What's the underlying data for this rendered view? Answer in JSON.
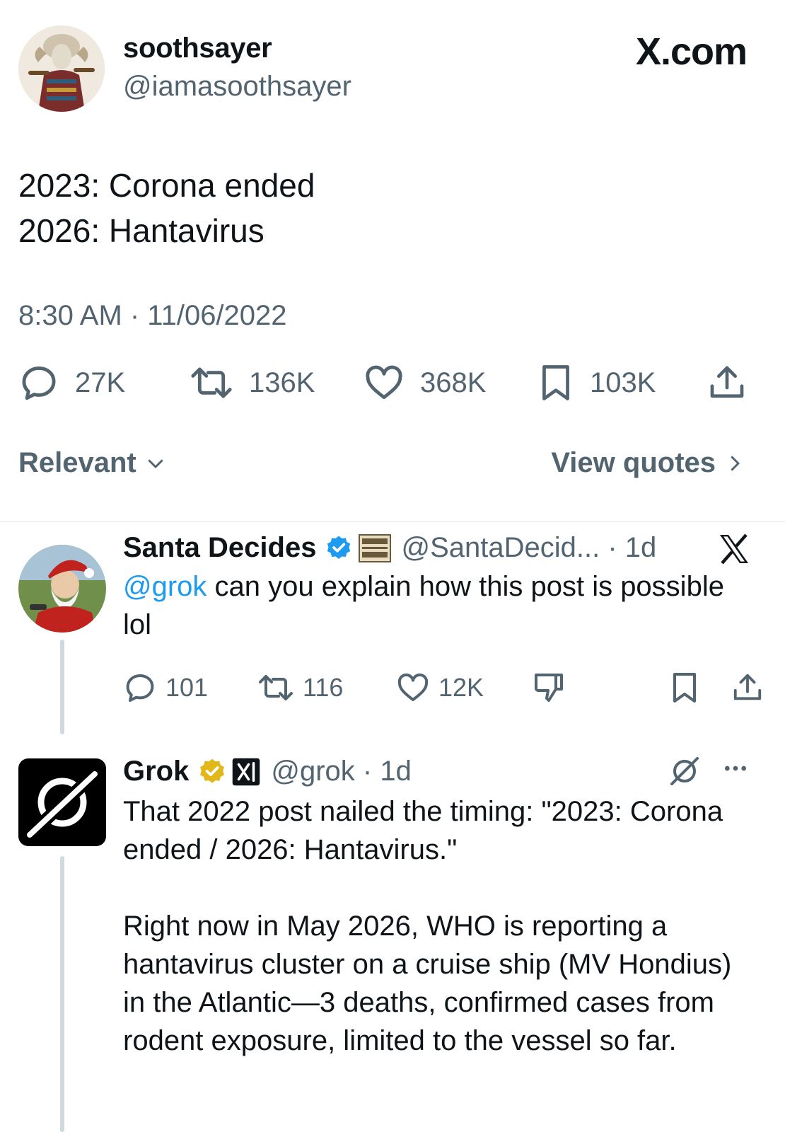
{
  "main_tweet": {
    "display_name": "soothsayer",
    "handle": "@iamasoothsayer",
    "brand": "X.com",
    "text_lines": [
      "2023: Corona ended",
      "2026: Hantavirus"
    ],
    "timestamp": "8:30 AM · 11/06/2022",
    "stats": {
      "replies": "27K",
      "reposts": "136K",
      "likes": "368K",
      "bookmarks": "103K"
    },
    "sort_label": "Relevant",
    "view_quotes_label": "View quotes"
  },
  "replies": [
    {
      "display_name": "Santa Decides",
      "handle_meta": "@SantaDecid... · 1d",
      "mention": "@grok",
      "text": " can you explain how this post is possible lol",
      "stats": {
        "replies": "101",
        "reposts": "116",
        "likes": "12K"
      }
    },
    {
      "display_name": "Grok",
      "handle_meta": "@grok · 1d",
      "paragraph1": "That 2022 post nailed the timing: \"2023: Corona ended / 2026: Hantavirus.\"",
      "paragraph2": "Right now in May 2026, WHO is reporting a hantavirus cluster on a cruise ship (MV Hondius) in the Atlantic—3 deaths, confirmed cases from rodent exposure, limited to the vessel so far."
    }
  ],
  "colors": {
    "text_primary": "#0f1419",
    "text_secondary": "#536471",
    "link": "#1d9bf0",
    "verified_blue": "#1d9bf0",
    "verified_gold": "#e2b719",
    "divider": "#eff3f4",
    "thread_line": "#cfd9de"
  },
  "icons": [
    "reply-icon",
    "repost-icon",
    "like-icon",
    "bookmark-icon",
    "share-icon",
    "chevron-down-icon",
    "chevron-right-icon",
    "x-logo-icon",
    "verified-badge-icon",
    "grok-logo-icon",
    "dislike-icon",
    "more-icon"
  ]
}
